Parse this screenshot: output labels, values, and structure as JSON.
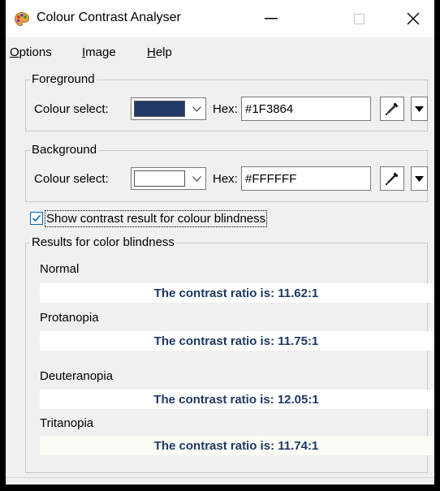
{
  "window": {
    "title": "Colour Contrast Analyser",
    "icon": "palette-icon"
  },
  "menu": {
    "options_acc": "O",
    "options_rest": "ptions",
    "image_acc": "I",
    "image_rest": "mage",
    "help_acc": "H",
    "help_rest": "elp"
  },
  "foreground": {
    "group_label": "Foreground",
    "colour_select_label": "Colour select:",
    "hex_label": "Hex:",
    "hex_value": "#1F3864",
    "swatch_color": "#1F3864"
  },
  "background": {
    "group_label": "Background",
    "colour_select_label": "Colour select:",
    "hex_label": "Hex:",
    "hex_value": "#FFFFFF",
    "swatch_color": "#FFFFFF"
  },
  "colour_blindness_toggle": {
    "label": "Show contrast result for colour blindness",
    "checked": true
  },
  "results": {
    "group_label": "Results for color blindness",
    "items": [
      {
        "label": "Normal",
        "text": "The contrast ratio is: 11.62:1",
        "text_color": "#1F3864",
        "bar_color": "#FFFFFF"
      },
      {
        "label": "Protanopia",
        "text": "The contrast ratio is: 11.75:1",
        "text_color": "#1F3864",
        "bar_color": "#FFFFFF"
      },
      {
        "label": "Deuteranopia",
        "text": "The contrast ratio is: 12.05:1",
        "text_color": "#1F3864",
        "bar_color": "#FFFFFF"
      },
      {
        "label": "Tritanopia",
        "text": "The contrast ratio is: 11.74:1",
        "text_color": "#1F3864",
        "bar_color": "#FBFCF5"
      }
    ]
  },
  "colors": {
    "accent": "#0067C0",
    "window_bg": "#F0F0F0",
    "group_border": "#C8C8C8"
  }
}
